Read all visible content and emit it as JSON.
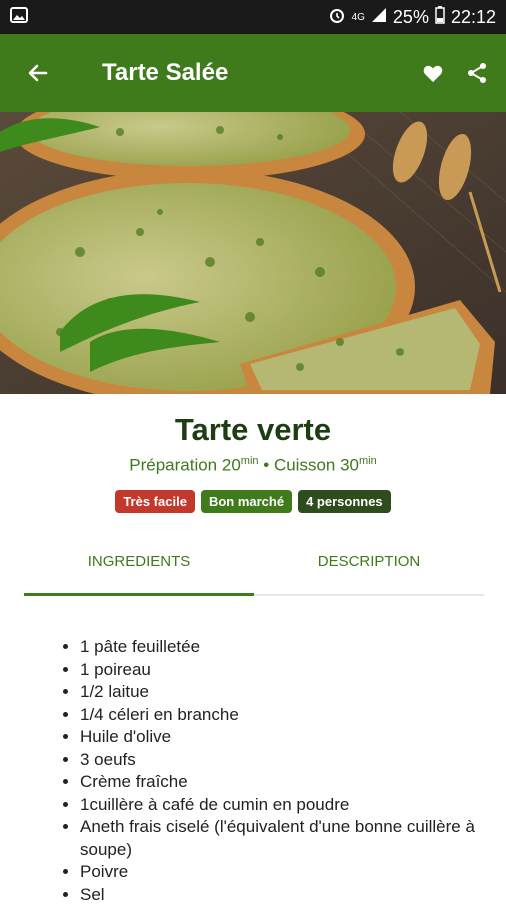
{
  "status_bar": {
    "network": "4G",
    "battery": "25%",
    "time": "22:12"
  },
  "app_bar": {
    "title": "Tarte Salée"
  },
  "recipe": {
    "title": "Tarte verte",
    "prep_label": "Préparation 20",
    "prep_unit": "min",
    "separator": "•",
    "cook_label": "Cuisson 30",
    "cook_unit": "min",
    "badges": [
      {
        "label": "Très facile",
        "color": "#c0392b"
      },
      {
        "label": "Bon marché",
        "color": "#3f7a1b"
      },
      {
        "label": "4 personnes",
        "color": "#2e4d1c"
      }
    ]
  },
  "tabs": [
    {
      "label": "INGREDIENTS",
      "active": true
    },
    {
      "label": "DESCRIPTION",
      "active": false
    }
  ],
  "ingredients": [
    "1 pâte feuilletée",
    "1 poireau",
    "1/2 laitue",
    "1/4 céleri en branche",
    "Huile d'olive",
    "3 oeufs",
    "Crème fraîche",
    "1cuillère à café de cumin en poudre",
    "Aneth frais ciselé (l'équivalent d'une bonne cuillère à soupe)",
    "Poivre",
    "Sel"
  ],
  "colors": {
    "primary": "#3f7a1b",
    "dark_green": "#1e3d12",
    "status_bar": "#1a1a1a"
  }
}
